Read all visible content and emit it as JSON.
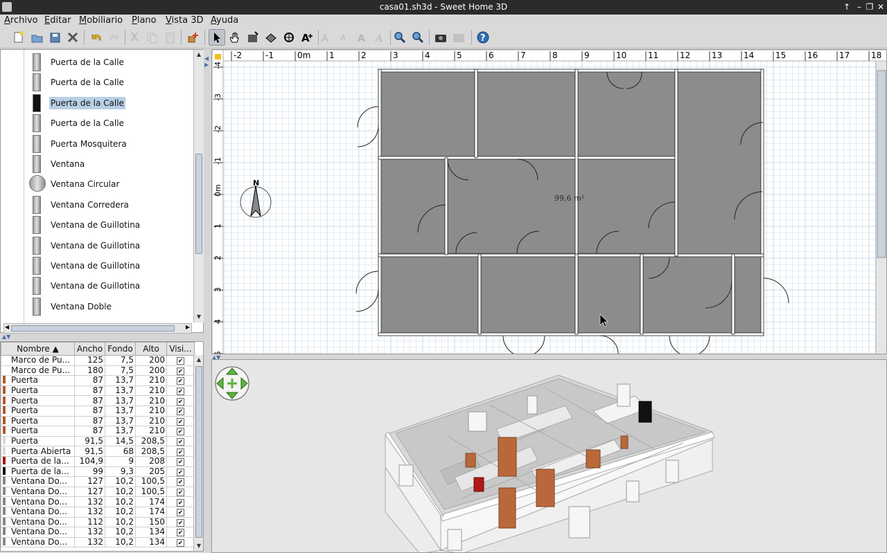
{
  "window": {
    "title": "casa01.sh3d - Sweet Home 3D",
    "controls": [
      "↑",
      "–",
      "❐",
      "✕"
    ]
  },
  "menu": [
    "Archivo",
    "Editar",
    "Mobiliario",
    "Plano",
    "Vista 3D",
    "Ayuda"
  ],
  "toolbar": {
    "buttons": [
      "new-file",
      "open",
      "save",
      "preferences",
      "undo",
      "redo",
      "cut",
      "copy",
      "paste",
      "add-furniture",
      "select-mode",
      "pan-mode",
      "create-walls",
      "create-rooms",
      "create-dimensions",
      "add-text",
      "text-style-1",
      "text-style-2",
      "text-style-3",
      "text-style-4",
      "zoom-in",
      "zoom-out",
      "create-photo",
      "create-video",
      "help"
    ],
    "selected": "select-mode"
  },
  "catalog": {
    "items": [
      {
        "label": "Puerta de la Calle",
        "selected": false
      },
      {
        "label": "Puerta de la Calle",
        "selected": false
      },
      {
        "label": "Puerta de la Calle",
        "selected": true
      },
      {
        "label": "Puerta de la Calle",
        "selected": false
      },
      {
        "label": "Puerta Mosquitera",
        "selected": false
      },
      {
        "label": "Ventana",
        "selected": false
      },
      {
        "label": "Ventana Circular",
        "selected": false
      },
      {
        "label": "Ventana Corredera",
        "selected": false
      },
      {
        "label": "Ventana de Guillotina",
        "selected": false
      },
      {
        "label": "Ventana de Guillotina",
        "selected": false
      },
      {
        "label": "Ventana de Guillotina",
        "selected": false
      },
      {
        "label": "Ventana de Guillotina",
        "selected": false
      },
      {
        "label": "Ventana Doble",
        "selected": false
      }
    ]
  },
  "furniture": {
    "headers": [
      "Nombre ▲",
      "Ancho",
      "Fondo",
      "Alto",
      "Visi..."
    ],
    "rows": [
      {
        "color": "#ffffff",
        "name": "Marco de Pu...",
        "w": "125",
        "d": "7,5",
        "h": "200",
        "v": "✔"
      },
      {
        "color": "#ffffff",
        "name": "Marco de Pu...",
        "w": "180",
        "d": "7,5",
        "h": "200",
        "v": "✔"
      },
      {
        "color": "#b05a2a",
        "name": "Puerta",
        "w": "87",
        "d": "13,7",
        "h": "210",
        "v": "✔"
      },
      {
        "color": "#b05a2a",
        "name": "Puerta",
        "w": "87",
        "d": "13,7",
        "h": "210",
        "v": "✔"
      },
      {
        "color": "#b05a2a",
        "name": "Puerta",
        "w": "87",
        "d": "13,7",
        "h": "210",
        "v": "✔"
      },
      {
        "color": "#b05a2a",
        "name": "Puerta",
        "w": "87",
        "d": "13,7",
        "h": "210",
        "v": "✔"
      },
      {
        "color": "#b05a2a",
        "name": "Puerta",
        "w": "87",
        "d": "13,7",
        "h": "210",
        "v": "✔"
      },
      {
        "color": "#b05a2a",
        "name": "Puerta",
        "w": "87",
        "d": "13,7",
        "h": "210",
        "v": "✔"
      },
      {
        "color": "#d8d8d8",
        "name": "Puerta",
        "w": "91,5",
        "d": "14,5",
        "h": "208,5",
        "v": "✔"
      },
      {
        "color": "#d8d8d8",
        "name": "Puerta Abierta",
        "w": "91,5",
        "d": "68",
        "h": "208,5",
        "v": "✔"
      },
      {
        "color": "#aa1111",
        "name": "Puerta de la...",
        "w": "104,9",
        "d": "9",
        "h": "208",
        "v": "✔"
      },
      {
        "color": "#111111",
        "name": "Puerta de la...",
        "w": "99",
        "d": "9,3",
        "h": "205",
        "v": "✔"
      },
      {
        "color": "#888888",
        "name": "Ventana Do...",
        "w": "127",
        "d": "10,2",
        "h": "100,5",
        "v": "✔"
      },
      {
        "color": "#888888",
        "name": "Ventana Do...",
        "w": "127",
        "d": "10,2",
        "h": "100,5",
        "v": "✔"
      },
      {
        "color": "#888888",
        "name": "Ventana Do...",
        "w": "132",
        "d": "10,2",
        "h": "174",
        "v": "✔"
      },
      {
        "color": "#888888",
        "name": "Ventana Do...",
        "w": "132",
        "d": "10,2",
        "h": "174",
        "v": "✔"
      },
      {
        "color": "#888888",
        "name": "Ventana Do...",
        "w": "112",
        "d": "10,2",
        "h": "150",
        "v": "✔"
      },
      {
        "color": "#888888",
        "name": "Ventana Do...",
        "w": "132",
        "d": "10,2",
        "h": "134",
        "v": "✔"
      },
      {
        "color": "#888888",
        "name": "Ventana Do...",
        "w": "132",
        "d": "10,2",
        "h": "134",
        "v": "✔"
      }
    ]
  },
  "plan": {
    "ruler_x": [
      "-2",
      "-1",
      "0m",
      "1",
      "2",
      "3",
      "4",
      "5",
      "6",
      "7",
      "8",
      "9",
      "10",
      "11",
      "12",
      "13",
      "14",
      "15",
      "16",
      "17",
      "18"
    ],
    "ruler_y": [
      "-4",
      "-3",
      "-2",
      "-1",
      "0m",
      "1",
      "2",
      "3",
      "4",
      "5"
    ],
    "compass_label": "N",
    "room_area": "99,6 m²"
  },
  "colors": {
    "room_fill": "#8c8c8c",
    "grid": "#c8dbe8",
    "selection": "#b8cfe5",
    "titlebar": "#2b2b2b",
    "navigator": "#5fb33f"
  }
}
